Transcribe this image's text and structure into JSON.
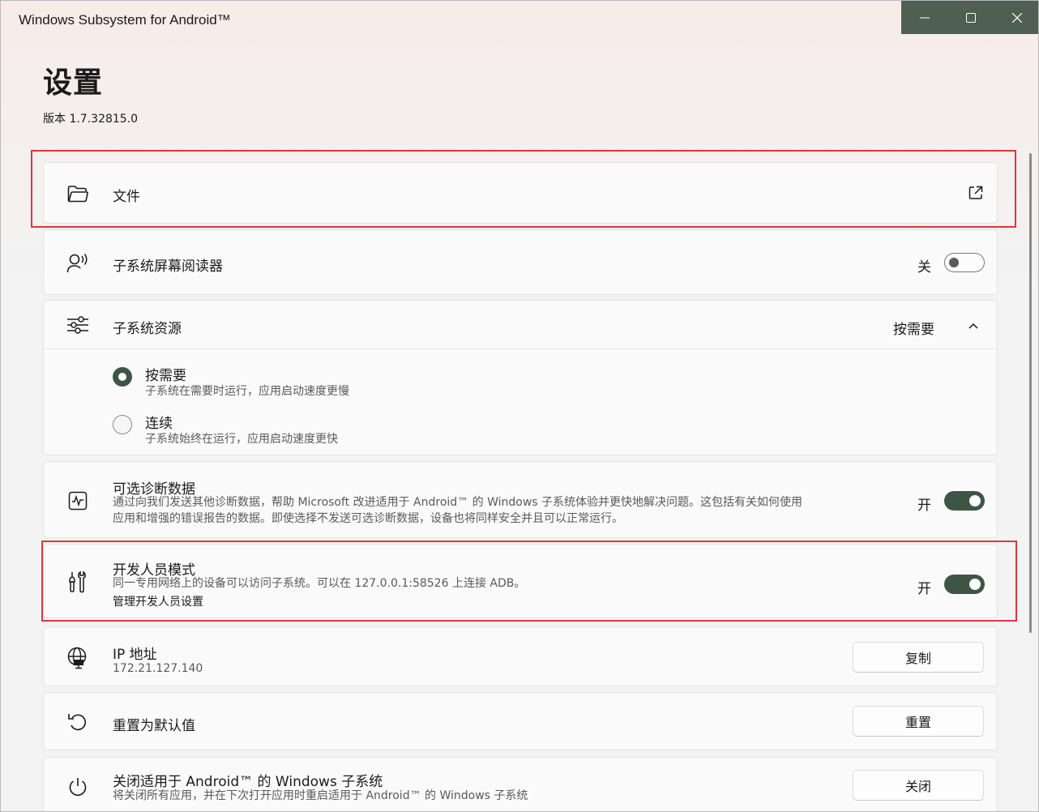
{
  "window": {
    "title": "Windows Subsystem for Android™"
  },
  "page": {
    "title": "设置",
    "version": "版本 1.7.32815.0"
  },
  "files": {
    "label": "文件"
  },
  "screen_reader": {
    "label": "子系统屏幕阅读器",
    "state": "关"
  },
  "resources": {
    "label": "子系统资源",
    "selected": "按需要",
    "options": [
      {
        "label": "按需要",
        "desc": "子系统在需要时运行，应用启动速度更慢"
      },
      {
        "label": "连续",
        "desc": "子系统始终在运行，应用启动速度更快"
      }
    ]
  },
  "diagnostics": {
    "label": "可选诊断数据",
    "desc_line1": "通过向我们发送其他诊断数据，帮助 Microsoft 改进适用于 Android™ 的 Windows 子系统体验并更快地解决问题。这包括有关如何使用",
    "desc_line2": "应用和增强的错误报告的数据。即使选择不发送可选诊断数据，设备也将同样安全并且可以正常运行。",
    "state": "开"
  },
  "developer": {
    "label": "开发人员模式",
    "desc": "同一专用网络上的设备可以访问子系统。可以在 127.0.0.1:58526 上连接 ADB。",
    "link": "管理开发人员设置",
    "state": "开"
  },
  "ip": {
    "label": "IP 地址",
    "value": "172.21.127.140",
    "button": "复制"
  },
  "reset": {
    "label": "重置为默认值",
    "button": "重置"
  },
  "shutdown": {
    "label": "关闭适用于 Android™ 的 Windows 子系统",
    "desc": "将关闭所有应用，并在下次打开应用时重启适用于 Android™ 的 Windows 子系统",
    "button": "关闭"
  },
  "colors": {
    "accent": "#3e5546",
    "highlight": "#e0353b"
  }
}
